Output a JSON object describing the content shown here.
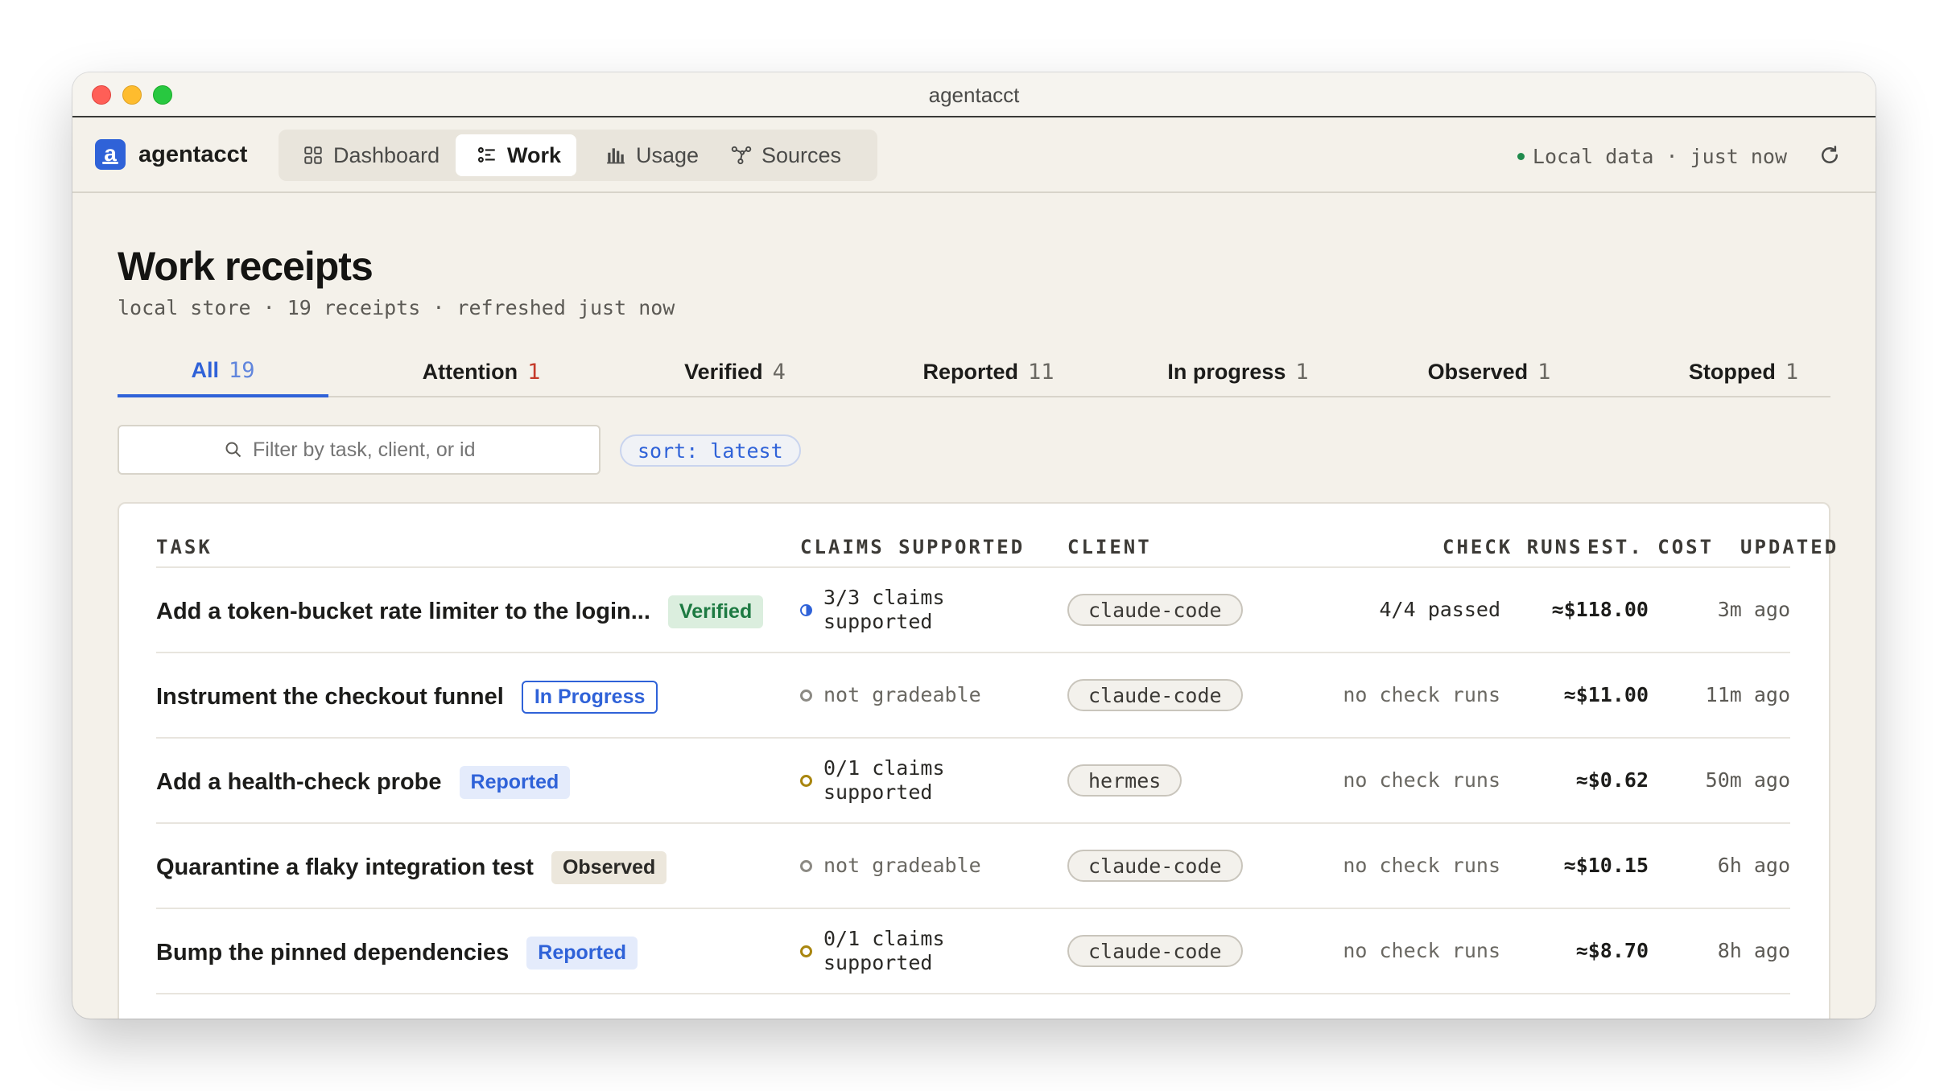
{
  "window": {
    "title": "agentacct"
  },
  "app": {
    "name": "agentacct",
    "logo_letter": "a"
  },
  "nav": {
    "tabs": [
      {
        "label": "Dashboard",
        "icon": "grid-icon"
      },
      {
        "label": "Work",
        "icon": "checklist-icon",
        "active": true
      },
      {
        "label": "Usage",
        "icon": "bar-chart-icon"
      },
      {
        "label": "Sources",
        "icon": "nodes-icon"
      }
    ]
  },
  "status": {
    "text": "Local data · just now",
    "dot_color": "#1f8a4c"
  },
  "page": {
    "title": "Work receipts",
    "subtitle": "local store · 19 receipts · refreshed just now"
  },
  "filters": {
    "tabs": [
      {
        "label": "All",
        "count": "19",
        "active": true
      },
      {
        "label": "Attention",
        "count": "1",
        "warn": true
      },
      {
        "label": "Verified",
        "count": "4"
      },
      {
        "label": "Reported",
        "count": "11"
      },
      {
        "label": "In progress",
        "count": "1"
      },
      {
        "label": "Observed",
        "count": "1"
      },
      {
        "label": "Stopped",
        "count": "1"
      }
    ],
    "search_placeholder": "Filter by task, client, or id",
    "sort_label": "sort: latest"
  },
  "table": {
    "columns": {
      "task": "TASK",
      "claims": "CLAIMS SUPPORTED",
      "client": "CLIENT",
      "checks": "CHECK RUNS",
      "cost": "EST. COST",
      "updated": "UPDATED"
    },
    "rows": [
      {
        "task": "Add a token-bucket rate limiter to the login...",
        "status": "Verified",
        "claims_line1": "3/3 claims",
        "claims_line2": "supported",
        "client": "claude-code",
        "checks": "4/4 passed",
        "cost": "≈$118.00",
        "updated": "3m ago"
      },
      {
        "task": "Instrument the checkout funnel",
        "status": "In Progress",
        "claims_line1": "not gradeable",
        "claims_line2": "",
        "client": "claude-code",
        "checks": "no check runs",
        "cost": "≈$11.00",
        "updated": "11m ago"
      },
      {
        "task": "Add a health-check probe",
        "status": "Reported",
        "claims_line1": "0/1 claims",
        "claims_line2": "supported",
        "client": "hermes",
        "checks": "no check runs",
        "cost": "≈$0.62",
        "updated": "50m ago"
      },
      {
        "task": "Quarantine a flaky integration test",
        "status": "Observed",
        "claims_line1": "not gradeable",
        "claims_line2": "",
        "client": "claude-code",
        "checks": "no check runs",
        "cost": "≈$10.15",
        "updated": "6h ago"
      },
      {
        "task": "Bump the pinned dependencies",
        "status": "Reported",
        "claims_line1": "0/1 claims",
        "claims_line2": "supported",
        "client": "claude-code",
        "checks": "no check runs",
        "cost": "≈$8.70",
        "updated": "8h ago"
      }
    ]
  }
}
